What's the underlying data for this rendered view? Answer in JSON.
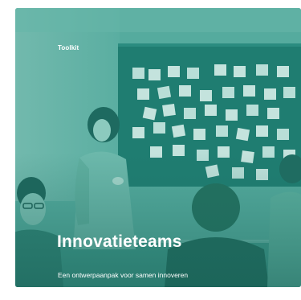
{
  "card": {
    "tag": "Toolkit",
    "title": "Innovatieteams",
    "subtitle": "Een ontwerpaanpak voor samen innoveren"
  },
  "colors": {
    "teal_base": "#4aa89a",
    "teal_dark": "#1f7d71",
    "sticky_note": "#d2ece6",
    "text": "#ffffff"
  }
}
